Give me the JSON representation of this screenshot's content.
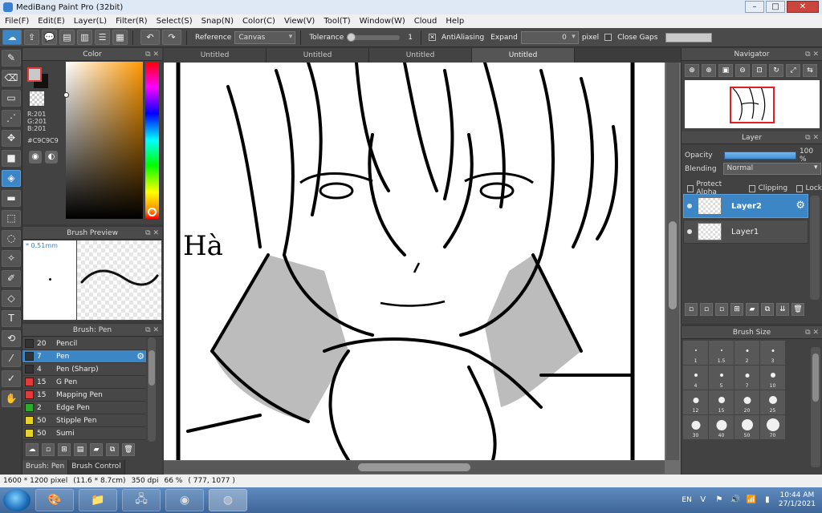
{
  "window": {
    "title": "MediBang Paint Pro (32bit)",
    "min": "–",
    "max": "□",
    "close": "✕"
  },
  "menu": [
    "File(F)",
    "Edit(E)",
    "Layer(L)",
    "Filter(R)",
    "Select(S)",
    "Snap(N)",
    "Color(C)",
    "View(V)",
    "Tool(T)",
    "Window(W)",
    "Cloud",
    "Help"
  ],
  "toolbar": {
    "reference_label": "Reference",
    "reference_value": "Canvas",
    "tolerance_label": "Tolerance",
    "tolerance_value": "1",
    "antialiasing_label": "AntiAliasing",
    "expand_label": "Expand",
    "expand_value": "0",
    "expand_unit": "pixel",
    "close_gaps_label": "Close Gaps",
    "antialiasing_checked": true
  },
  "color_panel": {
    "title": "Color",
    "rgb": [
      "R:201",
      "G:201",
      "B:201"
    ],
    "hex": "#C9C9C9",
    "current_color": "#c9c9c9"
  },
  "brush_preview": {
    "title": "Brush Preview",
    "size": "* 0.51mm"
  },
  "brush_list": {
    "title": "Brush: Pen",
    "items": [
      {
        "size": "20",
        "name": "Pencil",
        "color": "#333333",
        "active": false
      },
      {
        "size": "7",
        "name": "Pen",
        "color": "#333333",
        "active": true
      },
      {
        "size": "4",
        "name": "Pen (Sharp)",
        "color": "#333333",
        "active": false
      },
      {
        "size": "15",
        "name": "G Pen",
        "color": "#e23b3b",
        "active": false
      },
      {
        "size": "15",
        "name": "Mapping Pen",
        "color": "#e23b3b",
        "active": false
      },
      {
        "size": "2",
        "name": "Edge Pen",
        "color": "#2cae2c",
        "active": false
      },
      {
        "size": "50",
        "name": "Stipple Pen",
        "color": "#e6d22a",
        "active": false
      },
      {
        "size": "50",
        "name": "Sumi",
        "color": "#e6d22a",
        "active": false
      }
    ],
    "tabs": [
      "Brush: Pen",
      "Brush Control"
    ]
  },
  "doc_tabs": [
    "Untitled",
    "Untitled",
    "Untitled",
    "Untitled"
  ],
  "canvas": {
    "signature_text": "Hà"
  },
  "navigator": {
    "title": "Navigator"
  },
  "layer_panel": {
    "title": "Layer",
    "opacity_label": "Opacity",
    "opacity_value": "100 %",
    "blending_label": "Blending",
    "blending_value": "Normal",
    "protect_alpha_label": "Protect Alpha",
    "clipping_label": "Clipping",
    "lock_label": "Lock",
    "layers": [
      {
        "name": "Layer2",
        "active": true
      },
      {
        "name": "Layer1",
        "active": false
      }
    ]
  },
  "brush_size": {
    "title": "Brush Size",
    "sizes": [
      "1",
      "1.5",
      "2",
      "3",
      "4",
      "5",
      "7",
      "10",
      "12",
      "15",
      "20",
      "25",
      "30",
      "40",
      "50",
      "70"
    ]
  },
  "status": {
    "dimensions": "1600 * 1200 pixel",
    "physical": "(11.6 * 8.7cm)",
    "dpi": "350 dpi",
    "zoom": "66 %",
    "coords": "( 777, 1077 )"
  },
  "taskbar": {
    "language": "EN",
    "time": "10:44 AM",
    "date": "27/1/2021"
  }
}
